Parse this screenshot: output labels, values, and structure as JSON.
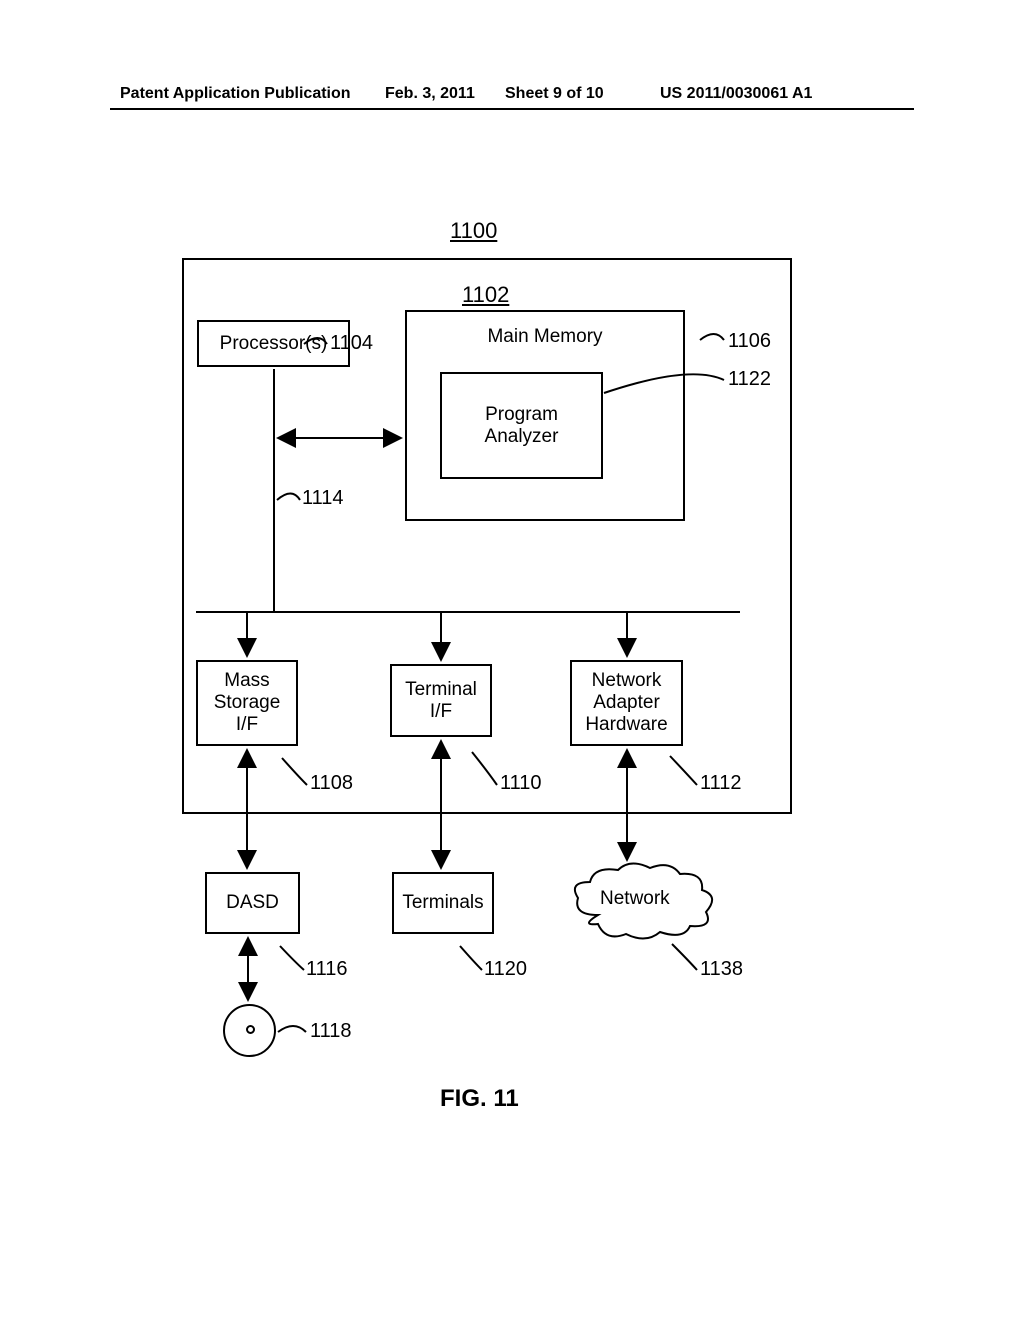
{
  "header": {
    "pubtype": "Patent Application Publication",
    "pubdate": "Feb. 3, 2011",
    "sheet": "Sheet 9 of 10",
    "pubnum": "US 2011/0030061 A1"
  },
  "refs": {
    "system": "1100",
    "cpu": "1102",
    "processor": "1104",
    "memory": "1106",
    "mass_if": "1108",
    "term_if": "1110",
    "net_hw": "1112",
    "bus": "1114",
    "dasd": "1116",
    "disc": "1118",
    "terminals": "1120",
    "analyzer": "1122",
    "network": "1138"
  },
  "labels": {
    "processor": "Processor(s)",
    "memory": "Main Memory",
    "analyzer": "Program\nAnalyzer",
    "mass_if": "Mass\nStorage\nI/F",
    "term_if": "Terminal\nI/F",
    "net_hw": "Network\nAdapter\nHardware",
    "dasd": "DASD",
    "terminals": "Terminals",
    "network": "Network"
  },
  "figure": "FIG. 11"
}
